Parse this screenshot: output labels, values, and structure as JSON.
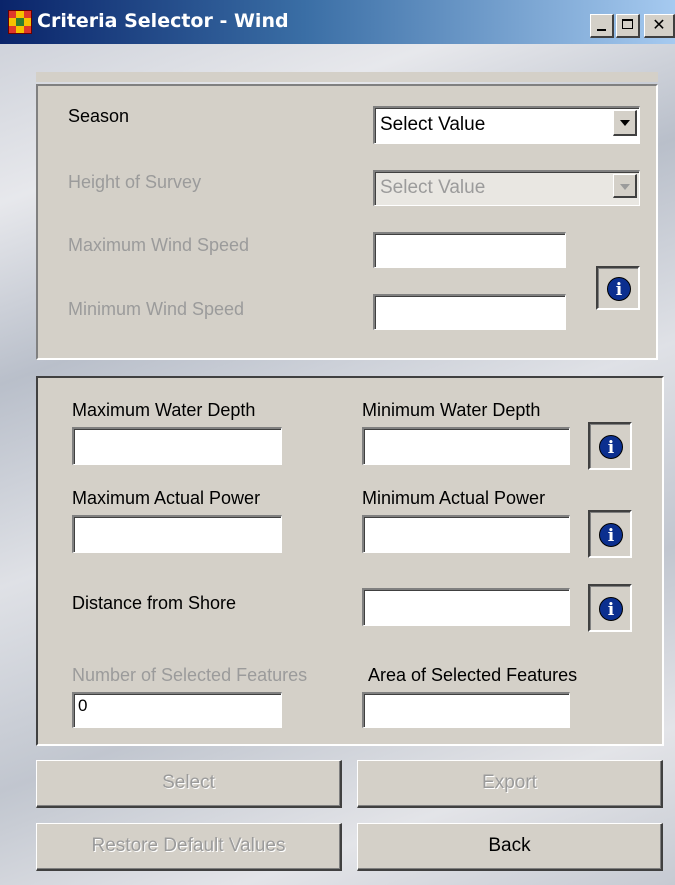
{
  "window": {
    "title": "Criteria Selector - Wind",
    "controls": [
      "minimize",
      "maximize",
      "close"
    ]
  },
  "wind_panel": {
    "season_label": "Season",
    "season_value": "Select Value",
    "height_label": "Height of Survey",
    "height_value": "Select Value",
    "max_wind_label": "Maximum Wind Speed",
    "max_wind_value": "",
    "min_wind_label": "Minimum Wind Speed",
    "min_wind_value": ""
  },
  "site_panel": {
    "max_depth_label": "Maximum Water Depth",
    "max_depth_value": "",
    "min_depth_label": "Minimum Water Depth",
    "min_depth_value": "",
    "max_power_label": "Maximum Actual Power",
    "max_power_value": "",
    "min_power_label": "Minimum Actual Power",
    "min_power_value": "",
    "distance_label": "Distance from Shore",
    "distance_value": "",
    "num_features_label": "Number of Selected Features",
    "num_features_value": "0",
    "area_features_label": "Area of Selected Features",
    "area_features_value": ""
  },
  "buttons": {
    "select": "Select",
    "export": "Export",
    "restore": "Restore Default Values",
    "back": "Back"
  },
  "icons": {
    "info": "i"
  },
  "colors": {
    "titlebar_start": "#0a246a",
    "titlebar_end": "#a6caf0",
    "face": "#d4d0c8",
    "disabled_text": "#9b9b9b",
    "info_blue": "#0b2f8f"
  }
}
